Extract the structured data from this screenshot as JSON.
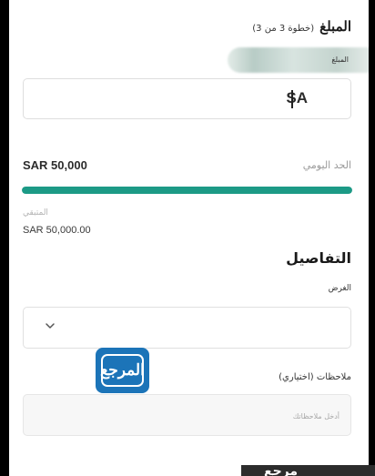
{
  "header": {
    "title": "المبلغ",
    "step": "(خطوة 3 من 3)"
  },
  "amount": {
    "label": "المبلغ",
    "value": "SA"
  },
  "daily_limit": {
    "label": "الحد اليومي",
    "value": "SAR 50,000",
    "used_fraction": 1.0,
    "bar_color": "#1c9a86"
  },
  "remaining": {
    "label": "المتبقي",
    "value": "SAR 50,000.00"
  },
  "details": {
    "title": "التفاصيل",
    "purpose_label": "الغرض",
    "purpose_icon": "chevron-down-icon",
    "notes_label": "ملاحظات (اختياري)",
    "notes_placeholder": "أدخل ملاحظاتك"
  },
  "watermark": {
    "text": "المرجع",
    "color": "#1c74b8"
  },
  "bottom_overlay": {
    "text": "مرجع"
  }
}
